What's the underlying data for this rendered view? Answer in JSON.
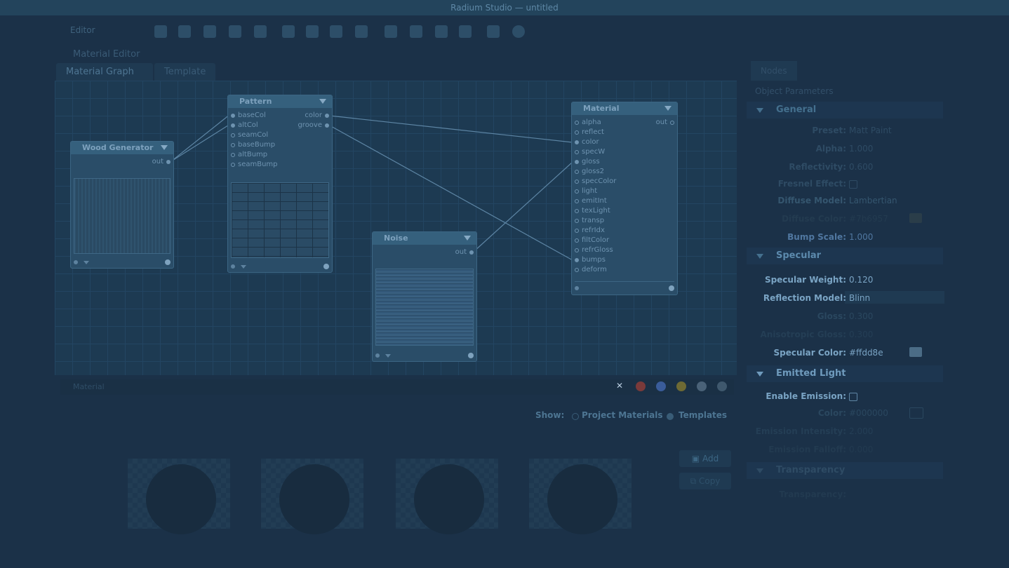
{
  "window": {
    "title": "Radium Studio — untitled"
  },
  "toolbar": {
    "mode_label": "Editor"
  },
  "panel": {
    "title": "Material Editor"
  },
  "tabs": [
    "Material Graph",
    "Template"
  ],
  "nodes": {
    "wood": {
      "title": "Wood Generator",
      "out": "out"
    },
    "pattern": {
      "title": "Pattern",
      "inputs": [
        "baseCol",
        "altCol",
        "seamCol",
        "baseBump",
        "altBump",
        "seamBump"
      ],
      "outputs": [
        "color",
        "groove"
      ]
    },
    "noise": {
      "title": "Noise",
      "out": "out"
    },
    "material": {
      "title": "Material",
      "out": "out",
      "inputs": [
        "alpha",
        "reflect",
        "color",
        "specW",
        "gloss",
        "gloss2",
        "specColor",
        "light",
        "emitInt",
        "texLight",
        "transp",
        "refrIdx",
        "filtColor",
        "refrGloss",
        "bumps",
        "deform"
      ]
    }
  },
  "search": {
    "text": "Material"
  },
  "browser": {
    "show_label": "Show:",
    "options": [
      "Project Materials",
      "Templates"
    ],
    "add_label": "Add",
    "copy_label": "Copy"
  },
  "colors": {
    "swatch_red": "#7a3a3a",
    "swatch_blue": "#3a5c9a",
    "swatch_yellow": "#6e6a34",
    "swatch_gray1": "#4a6278",
    "swatch_gray2": "#3f586d"
  },
  "props": {
    "tab": "Nodes",
    "object_params": "Object Parameters",
    "general": {
      "title": "General",
      "rows": [
        {
          "label": "Preset:",
          "value": "Matt Paint"
        },
        {
          "label": "Alpha:",
          "value": "1.000"
        },
        {
          "label": "Reflectivity:",
          "value": "0.600"
        },
        {
          "label": "Fresnel Effect:",
          "value": ""
        },
        {
          "label": "Diffuse Model:",
          "value": "Lambertian"
        },
        {
          "label": "Diffuse Color:",
          "value": "#7b6957"
        },
        {
          "label": "Bump Scale:",
          "value": "1.000"
        }
      ]
    },
    "specular": {
      "title": "Specular",
      "rows": [
        {
          "label": "Specular Weight:",
          "value": "0.120"
        },
        {
          "label": "Reflection Model:",
          "value": "Blinn"
        },
        {
          "label": "Gloss:",
          "value": "0.300"
        },
        {
          "label": "Anisotropic Gloss:",
          "value": "0.300"
        },
        {
          "label": "Specular Color:",
          "value": "#ffdd8e"
        }
      ]
    },
    "emitted": {
      "title": "Emitted Light",
      "rows": [
        {
          "label": "Enable Emission:",
          "value": ""
        },
        {
          "label": "Color:",
          "value": "#000000"
        },
        {
          "label": "Emission Intensity:",
          "value": "2.000"
        },
        {
          "label": "Emission Falloff:",
          "value": "0.000"
        }
      ]
    },
    "transparency": {
      "title": "Transparency",
      "row_label": "Transparency:"
    }
  }
}
